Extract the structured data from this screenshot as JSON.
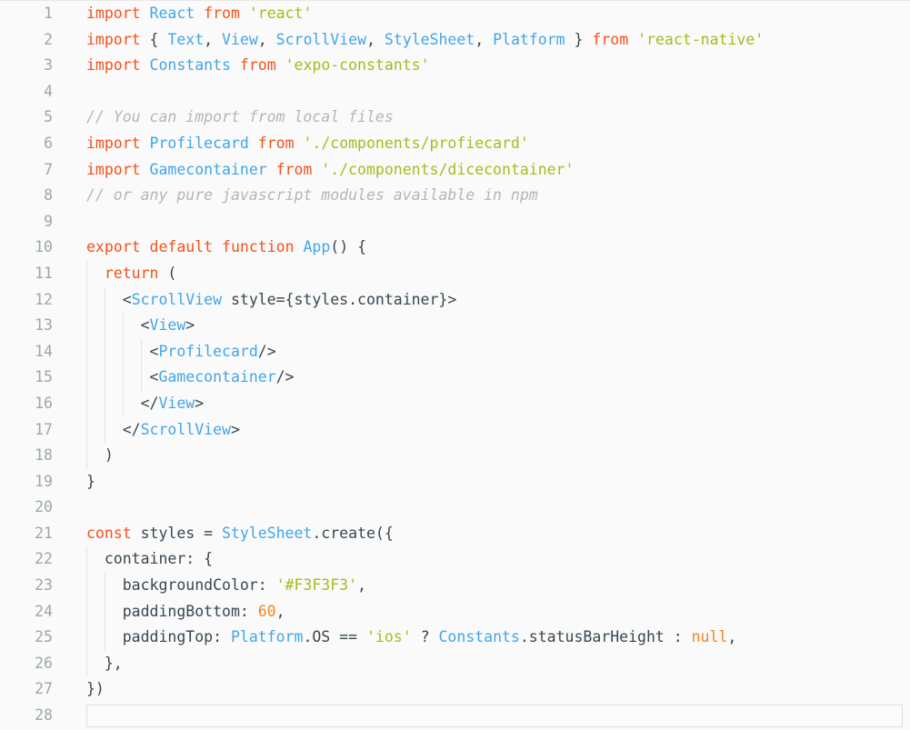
{
  "editor": {
    "background": "#fafafa",
    "language": "javascript-jsx",
    "total_lines": 28,
    "current_line": 28,
    "colors": {
      "keyword": "#f4511e",
      "identifier": "#42a5e8",
      "string": "#9ebf1c",
      "number": "#f4851e",
      "comment": "#b0b7bb",
      "plain": "#37474f",
      "line_number": "#9aa7ae",
      "indent_guide": "#e3e3e3",
      "current_line_border": "#e0e0e0"
    }
  },
  "lines": [
    {
      "n": "1",
      "indent": 0,
      "tokens": [
        {
          "t": "import",
          "c": "kw"
        },
        {
          "t": " ",
          "c": "pln"
        },
        {
          "t": "React",
          "c": "id"
        },
        {
          "t": " ",
          "c": "pln"
        },
        {
          "t": "from",
          "c": "kw"
        },
        {
          "t": " ",
          "c": "pln"
        },
        {
          "t": "'react'",
          "c": "str"
        }
      ]
    },
    {
      "n": "2",
      "indent": 0,
      "tokens": [
        {
          "t": "import",
          "c": "kw"
        },
        {
          "t": " { ",
          "c": "pln"
        },
        {
          "t": "Text",
          "c": "id"
        },
        {
          "t": ", ",
          "c": "pln"
        },
        {
          "t": "View",
          "c": "id"
        },
        {
          "t": ", ",
          "c": "pln"
        },
        {
          "t": "ScrollView",
          "c": "id"
        },
        {
          "t": ", ",
          "c": "pln"
        },
        {
          "t": "StyleSheet",
          "c": "id"
        },
        {
          "t": ", ",
          "c": "pln"
        },
        {
          "t": "Platform",
          "c": "id"
        },
        {
          "t": " } ",
          "c": "pln"
        },
        {
          "t": "from",
          "c": "kw"
        },
        {
          "t": " ",
          "c": "pln"
        },
        {
          "t": "'react-native'",
          "c": "str"
        }
      ]
    },
    {
      "n": "3",
      "indent": 0,
      "tokens": [
        {
          "t": "import",
          "c": "kw"
        },
        {
          "t": " ",
          "c": "pln"
        },
        {
          "t": "Constants",
          "c": "id"
        },
        {
          "t": " ",
          "c": "pln"
        },
        {
          "t": "from",
          "c": "kw"
        },
        {
          "t": " ",
          "c": "pln"
        },
        {
          "t": "'expo-constants'",
          "c": "str"
        }
      ]
    },
    {
      "n": "4",
      "indent": 0,
      "tokens": []
    },
    {
      "n": "5",
      "indent": 0,
      "tokens": [
        {
          "t": "// You can import from local files",
          "c": "com"
        }
      ]
    },
    {
      "n": "6",
      "indent": 0,
      "tokens": [
        {
          "t": "import",
          "c": "kw"
        },
        {
          "t": " ",
          "c": "pln"
        },
        {
          "t": "Profilecard",
          "c": "id"
        },
        {
          "t": " ",
          "c": "pln"
        },
        {
          "t": "from",
          "c": "kw"
        },
        {
          "t": " ",
          "c": "pln"
        },
        {
          "t": "'./components/profiecard'",
          "c": "str"
        }
      ]
    },
    {
      "n": "7",
      "indent": 0,
      "tokens": [
        {
          "t": "import",
          "c": "kw"
        },
        {
          "t": " ",
          "c": "pln"
        },
        {
          "t": "Gamecontainer",
          "c": "id"
        },
        {
          "t": " ",
          "c": "pln"
        },
        {
          "t": "from",
          "c": "kw"
        },
        {
          "t": " ",
          "c": "pln"
        },
        {
          "t": "'./components/dicecontainer'",
          "c": "str"
        }
      ]
    },
    {
      "n": "8",
      "indent": 0,
      "tokens": [
        {
          "t": "// or any pure javascript modules available in npm",
          "c": "com"
        }
      ]
    },
    {
      "n": "9",
      "indent": 0,
      "tokens": []
    },
    {
      "n": "10",
      "indent": 0,
      "tokens": [
        {
          "t": "export",
          "c": "kw"
        },
        {
          "t": " ",
          "c": "pln"
        },
        {
          "t": "default",
          "c": "kw"
        },
        {
          "t": " ",
          "c": "pln"
        },
        {
          "t": "function",
          "c": "kw"
        },
        {
          "t": " ",
          "c": "pln"
        },
        {
          "t": "App",
          "c": "id"
        },
        {
          "t": "() {",
          "c": "pln"
        }
      ]
    },
    {
      "n": "11",
      "indent": 1,
      "tokens": [
        {
          "t": "  ",
          "c": "pln"
        },
        {
          "t": "return",
          "c": "kw"
        },
        {
          "t": " (",
          "c": "pln"
        }
      ]
    },
    {
      "n": "12",
      "indent": 2,
      "tokens": [
        {
          "t": "    <",
          "c": "pun"
        },
        {
          "t": "ScrollView",
          "c": "id"
        },
        {
          "t": " style={styles.container}>",
          "c": "pln"
        }
      ]
    },
    {
      "n": "13",
      "indent": 3,
      "tokens": [
        {
          "t": "      <",
          "c": "pun"
        },
        {
          "t": "View",
          "c": "id"
        },
        {
          "t": ">",
          "c": "pun"
        }
      ]
    },
    {
      "n": "14",
      "indent": 4,
      "tokens": [
        {
          "t": "       <",
          "c": "pun"
        },
        {
          "t": "Profilecard",
          "c": "id"
        },
        {
          "t": "/>",
          "c": "pun"
        }
      ]
    },
    {
      "n": "15",
      "indent": 4,
      "tokens": [
        {
          "t": "       <",
          "c": "pun"
        },
        {
          "t": "Gamecontainer",
          "c": "id"
        },
        {
          "t": "/>",
          "c": "pun"
        }
      ]
    },
    {
      "n": "16",
      "indent": 3,
      "tokens": [
        {
          "t": "      </",
          "c": "pun"
        },
        {
          "t": "View",
          "c": "id"
        },
        {
          "t": ">",
          "c": "pun"
        }
      ]
    },
    {
      "n": "17",
      "indent": 2,
      "tokens": [
        {
          "t": "    </",
          "c": "pun"
        },
        {
          "t": "ScrollView",
          "c": "id"
        },
        {
          "t": ">",
          "c": "pun"
        }
      ]
    },
    {
      "n": "18",
      "indent": 1,
      "tokens": [
        {
          "t": "  )",
          "c": "pln"
        }
      ]
    },
    {
      "n": "19",
      "indent": 0,
      "tokens": [
        {
          "t": "}",
          "c": "pln"
        }
      ]
    },
    {
      "n": "20",
      "indent": 0,
      "tokens": []
    },
    {
      "n": "21",
      "indent": 0,
      "tokens": [
        {
          "t": "const",
          "c": "kw"
        },
        {
          "t": " styles = ",
          "c": "pln"
        },
        {
          "t": "StyleSheet",
          "c": "id"
        },
        {
          "t": ".create({",
          "c": "pln"
        }
      ]
    },
    {
      "n": "22",
      "indent": 1,
      "tokens": [
        {
          "t": "  container: {",
          "c": "pln"
        }
      ]
    },
    {
      "n": "23",
      "indent": 2,
      "tokens": [
        {
          "t": "    backgroundColor: ",
          "c": "pln"
        },
        {
          "t": "'#F3F3F3'",
          "c": "str"
        },
        {
          "t": ",",
          "c": "pln"
        }
      ]
    },
    {
      "n": "24",
      "indent": 2,
      "tokens": [
        {
          "t": "    paddingBottom: ",
          "c": "pln"
        },
        {
          "t": "60",
          "c": "num"
        },
        {
          "t": ",",
          "c": "pln"
        }
      ]
    },
    {
      "n": "25",
      "indent": 2,
      "tokens": [
        {
          "t": "    paddingTop: ",
          "c": "pln"
        },
        {
          "t": "Platform",
          "c": "id"
        },
        {
          "t": ".OS == ",
          "c": "pln"
        },
        {
          "t": "'ios'",
          "c": "str"
        },
        {
          "t": " ? ",
          "c": "pln"
        },
        {
          "t": "Constants",
          "c": "id"
        },
        {
          "t": ".statusBarHeight : ",
          "c": "pln"
        },
        {
          "t": "null",
          "c": "num"
        },
        {
          "t": ",",
          "c": "pln"
        }
      ]
    },
    {
      "n": "26",
      "indent": 1,
      "tokens": [
        {
          "t": "  },",
          "c": "pln"
        }
      ]
    },
    {
      "n": "27",
      "indent": 0,
      "tokens": [
        {
          "t": "})",
          "c": "pln"
        }
      ]
    },
    {
      "n": "28",
      "indent": 0,
      "tokens": [],
      "current": true
    }
  ]
}
